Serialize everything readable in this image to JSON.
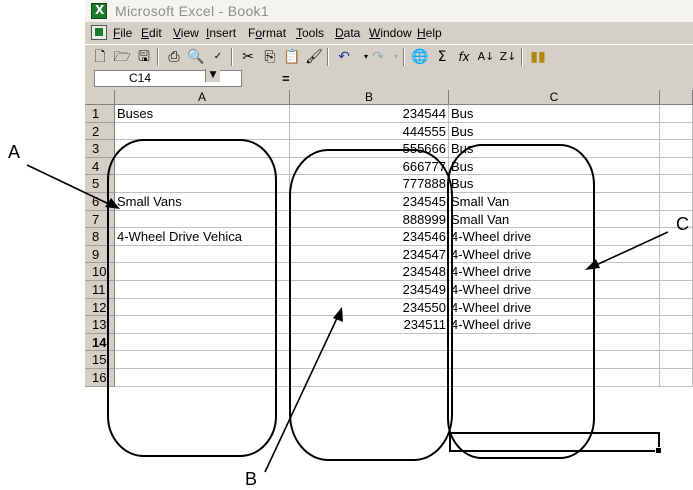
{
  "window": {
    "title": "Microsoft Excel - Book1"
  },
  "menu": [
    {
      "label": "File",
      "u": "F",
      "rest": "ile"
    },
    {
      "label": "Edit",
      "u": "E",
      "rest": "dit"
    },
    {
      "label": "View",
      "u": "V",
      "rest": "iew"
    },
    {
      "label": "Insert",
      "u": "I",
      "rest": "nsert"
    },
    {
      "label": "Format",
      "pre": "F",
      "u": "o",
      "rest": "rmat"
    },
    {
      "label": "Tools",
      "u": "T",
      "rest": "ools"
    },
    {
      "label": "Data",
      "u": "D",
      "rest": "ata"
    },
    {
      "label": "Window",
      "u": "W",
      "rest": "indow"
    },
    {
      "label": "Help",
      "u": "H",
      "rest": "elp"
    }
  ],
  "toolbar_icons": [
    "new-icon",
    "open-icon",
    "save-icon",
    "print-icon",
    "print-preview-icon",
    "spelling-icon",
    "cut-icon",
    "copy-icon",
    "paste-icon",
    "format-painter-icon",
    "undo-icon",
    "redo-icon",
    "hyperlink-icon",
    "autosum-icon",
    "function-icon",
    "sort-ascending-icon",
    "sort-descending-icon",
    "chart-wizard-icon"
  ],
  "toolbar_glyphs": {
    "autosum": "Σ",
    "function": "fx"
  },
  "formula_bar": {
    "name_box": "C14",
    "equals": "="
  },
  "columns": [
    "A",
    "B",
    "C"
  ],
  "rows": [
    {
      "n": "1",
      "a": "Buses",
      "b": "234544",
      "c": "Bus"
    },
    {
      "n": "2",
      "a": "",
      "b": "444555",
      "c": "Bus"
    },
    {
      "n": "3",
      "a": "",
      "b": "555666",
      "c": "Bus"
    },
    {
      "n": "4",
      "a": "",
      "b": "666777",
      "c": "Bus"
    },
    {
      "n": "5",
      "a": "",
      "b": "777888",
      "c": "Bus"
    },
    {
      "n": "6",
      "a": "Small Vans",
      "b": "234545",
      "c": "Small Van"
    },
    {
      "n": "7",
      "a": "",
      "b": "888999",
      "c": "Small Van"
    },
    {
      "n": "8",
      "a": "4-Wheel Drive Vehica",
      "b": "234546",
      "c": "4-Wheel drive"
    },
    {
      "n": "9",
      "a": "",
      "b": "234547",
      "c": "4-Wheel drive"
    },
    {
      "n": "10",
      "a": "",
      "b": "234548",
      "c": "4-Wheel drive"
    },
    {
      "n": "11",
      "a": "",
      "b": "234549",
      "c": "4-Wheel drive"
    },
    {
      "n": "12",
      "a": "",
      "b": "234550",
      "c": "4-Wheel drive"
    },
    {
      "n": "13",
      "a": "",
      "b": "234511",
      "c": "4-Wheel drive"
    },
    {
      "n": "14",
      "a": "",
      "b": "",
      "c": ""
    },
    {
      "n": "15",
      "a": "",
      "b": "",
      "c": ""
    },
    {
      "n": "16",
      "a": "",
      "b": "",
      "c": ""
    }
  ],
  "active_row": "14",
  "callouts": {
    "a": "A",
    "b": "B",
    "c": "C"
  },
  "colors": {
    "chrome": "#d4d0c8",
    "title_text": "#8e8e8e",
    "excel_green": "#1d7a2d"
  }
}
